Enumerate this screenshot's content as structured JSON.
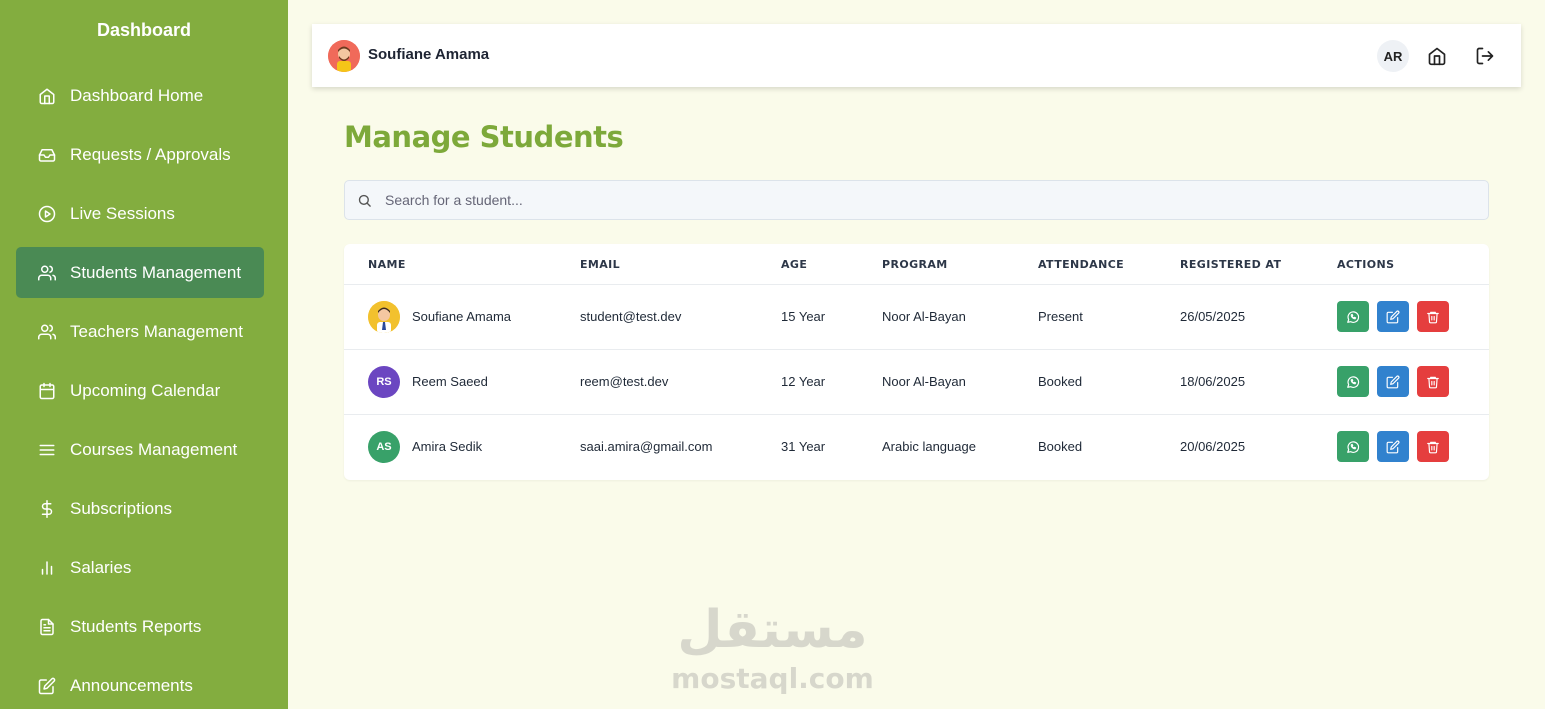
{
  "sidebar": {
    "title": "Dashboard",
    "items": [
      {
        "label": "Dashboard Home",
        "icon": "home-icon",
        "active": false
      },
      {
        "label": "Requests / Approvals",
        "icon": "inbox-icon",
        "active": false
      },
      {
        "label": "Live Sessions",
        "icon": "play-circle-icon",
        "active": false
      },
      {
        "label": "Students Management",
        "icon": "users-icon",
        "active": true
      },
      {
        "label": "Teachers Management",
        "icon": "users-icon",
        "active": false
      },
      {
        "label": "Upcoming Calendar",
        "icon": "calendar-icon",
        "active": false
      },
      {
        "label": "Courses Management",
        "icon": "menu-icon",
        "active": false
      },
      {
        "label": "Subscriptions",
        "icon": "dollar-icon",
        "active": false
      },
      {
        "label": "Salaries",
        "icon": "bar-chart-icon",
        "active": false
      },
      {
        "label": "Students Reports",
        "icon": "file-text-icon",
        "active": false
      },
      {
        "label": "Announcements",
        "icon": "edit-icon",
        "active": false
      }
    ]
  },
  "topbar": {
    "user_name": "Soufiane Amama",
    "lang_button": "AR",
    "icons": [
      "home-icon",
      "logout-icon"
    ]
  },
  "main": {
    "title": "Manage Students",
    "search_placeholder": "Search for a student..."
  },
  "table": {
    "headers": [
      "NAME",
      "EMAIL",
      "AGE",
      "PROGRAM",
      "ATTENDANCE",
      "REGISTERED AT",
      "ACTIONS"
    ],
    "rows": [
      {
        "initials": "",
        "avatar_color": "#f2c12e",
        "name": "Soufiane Amama",
        "email": "student@test.dev",
        "age": "15 Year",
        "program": "Noor Al-Bayan",
        "attendance": "Present",
        "registered": "26/05/2025"
      },
      {
        "initials": "RS",
        "avatar_color": "#6b46c1",
        "name": "Reem Saeed",
        "email": "reem@test.dev",
        "age": "12 Year",
        "program": "Noor Al-Bayan",
        "attendance": "Booked",
        "registered": "18/06/2025"
      },
      {
        "initials": "AS",
        "avatar_color": "#38a169",
        "name": "Amira Sedik",
        "email": "saai.amira@gmail.com",
        "age": "31 Year",
        "program": "Arabic language",
        "attendance": "Booked",
        "registered": "20/06/2025"
      }
    ],
    "actions": [
      "whatsapp-icon",
      "edit-icon",
      "trash-icon"
    ]
  },
  "watermark": {
    "arabic": "مستقل",
    "latin": "mostaql.com"
  },
  "colors": {
    "sidebar": "#83ad3f",
    "active_item": "#4a8a54",
    "title": "#7da93a",
    "whatsapp": "#38a169",
    "edit": "#3182ce",
    "delete": "#e53e3e"
  }
}
